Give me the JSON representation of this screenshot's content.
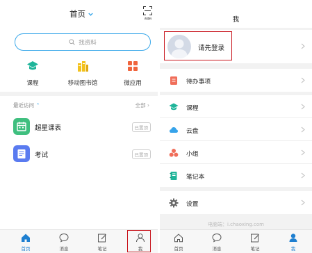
{
  "left": {
    "title": "首页",
    "scan_label": "资源码",
    "search_placeholder": "找资料",
    "tiles": [
      {
        "label": "课程",
        "icon": "graduation-cap-icon",
        "color": "#1fb59a"
      },
      {
        "label": "移动图书馆",
        "icon": "books-icon",
        "color": "#f3c21e"
      },
      {
        "label": "微应用",
        "icon": "grid-apps-icon",
        "color": "#f0643c"
      }
    ],
    "recent": {
      "label": "最近访问",
      "all_label": "全部",
      "items": [
        {
          "label": "超星课表",
          "pin": "已置顶",
          "icon": "calendar-icon",
          "color": "#3fbf7f"
        },
        {
          "label": "考试",
          "pin": "已置顶",
          "icon": "exam-icon",
          "color": "#5a7bf0"
        }
      ]
    },
    "tabs": [
      {
        "label": "首页",
        "icon": "home-icon",
        "active": true
      },
      {
        "label": "消息",
        "icon": "chat-bubble-icon",
        "active": false
      },
      {
        "label": "笔记",
        "icon": "note-edit-icon",
        "active": false
      },
      {
        "label": "我",
        "icon": "person-icon",
        "active": false
      }
    ]
  },
  "right": {
    "title": "我",
    "login_label": "请先登录",
    "menu_groups": [
      [
        {
          "label": "待办事项",
          "icon": "todo-icon",
          "color": "#f06e5a"
        }
      ],
      [
        {
          "label": "课程",
          "icon": "graduation-cap-icon",
          "color": "#1fb59a"
        },
        {
          "label": "云盘",
          "icon": "cloud-icon",
          "color": "#36a3ea"
        },
        {
          "label": "小组",
          "icon": "group-icon",
          "color": "#f06e5a"
        },
        {
          "label": "笔记本",
          "icon": "notebook-icon",
          "color": "#1fb59a"
        }
      ],
      [
        {
          "label": "设置",
          "icon": "gear-icon",
          "color": "#666666"
        }
      ]
    ],
    "footer": "电脑端：i.chaoxing.com",
    "tabs": [
      {
        "label": "首页",
        "icon": "home-icon",
        "active": false
      },
      {
        "label": "消息",
        "icon": "chat-bubble-icon",
        "active": false
      },
      {
        "label": "笔记",
        "icon": "note-edit-icon",
        "active": false
      },
      {
        "label": "我",
        "icon": "person-icon",
        "active": true
      }
    ]
  },
  "colors": {
    "accent": "#1e7fd0",
    "highlight": "#c8141c",
    "search_border": "#3aa8ea"
  }
}
